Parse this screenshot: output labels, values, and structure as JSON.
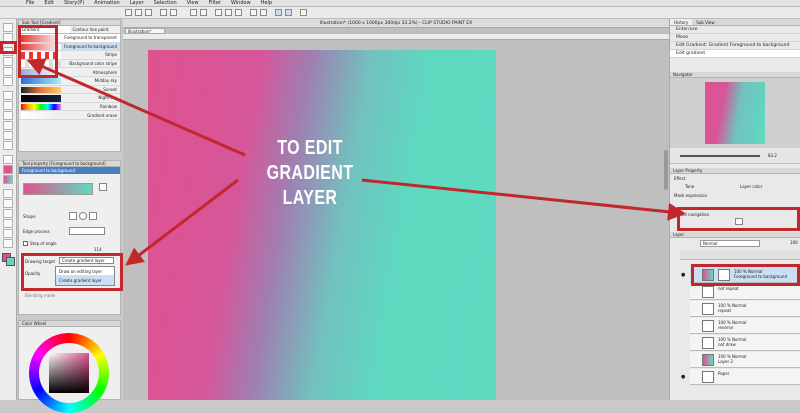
{
  "menu": [
    "File",
    "Edit",
    "Story(P)",
    "Animation",
    "Layer",
    "Selection",
    "View",
    "Filter",
    "Window",
    "Help"
  ],
  "document_title": "Illustration* (1000 x 1000px 300dpi 33.2%) - CLIP STUDIO PAINT EX",
  "doc_tab": "Illustration*",
  "sub_tool_panel": {
    "title": "Sub Tool [Gradient]",
    "tabs": [
      "Gradient",
      "Contour line paint"
    ],
    "items": [
      "Foreground to transparent",
      "Foreground to background",
      "Stripe",
      "Background color stripe",
      "Atmosphere",
      "Midday sky",
      "Sunset",
      "Night sky",
      "Rainbow",
      "Gradient erase"
    ]
  },
  "tool_property": {
    "title": "Tool property [Foreground to background]",
    "preset_name": "Foreground to background",
    "shape_label": "Shape",
    "edge_process_label": "Edge process",
    "step_of_angle_label": "Step of angle",
    "step_value": "114",
    "drawing_target_label": "Drawing target",
    "drawing_target_value": "Create gradient layer",
    "opacity_label": "Opacity",
    "dropdown_options": [
      "Draw on editing layer",
      "Create gradient layer"
    ],
    "blending_label": "Blending mode"
  },
  "color_wheel_title": "Color Wheel",
  "caption": {
    "line1": "TO EDIT GRADIENT",
    "line2": "LAYER"
  },
  "history": {
    "tabs": [
      "History",
      "Sub View"
    ],
    "items": [
      "Enter/use",
      "Move",
      "Edit Gradient: Gradient Foreground to background",
      "Edit gradient"
    ]
  },
  "navigator_title": "Navigator",
  "zoom_value": "83.2",
  "layer_property": {
    "title": "Layer Property",
    "effect_label": "Effect",
    "tone_label": "Tone",
    "layer_color_label": "Layer color",
    "mask_label": "Mask expression",
    "tool_nav_label": "Tool navigation"
  },
  "layer_panel": {
    "title": "Layer",
    "blend_mode": "Normal",
    "opacity": "100",
    "layers": [
      {
        "pct": "100 % Normal",
        "name": "Foreground to background"
      },
      {
        "pct": "",
        "name": "not repeat"
      },
      {
        "pct": "100 % Normal",
        "name": "repeat"
      },
      {
        "pct": "100 % Normal",
        "name": "reverse"
      },
      {
        "pct": "100 % Normal",
        "name": "not draw"
      },
      {
        "pct": "100 % Normal",
        "name": "Layer 2"
      },
      {
        "pct": "",
        "name": "Paper"
      }
    ]
  },
  "colors": {
    "accent_red": "#c0282c",
    "canvas_pink": "#e0528f",
    "canvas_teal": "#5fdac1"
  }
}
